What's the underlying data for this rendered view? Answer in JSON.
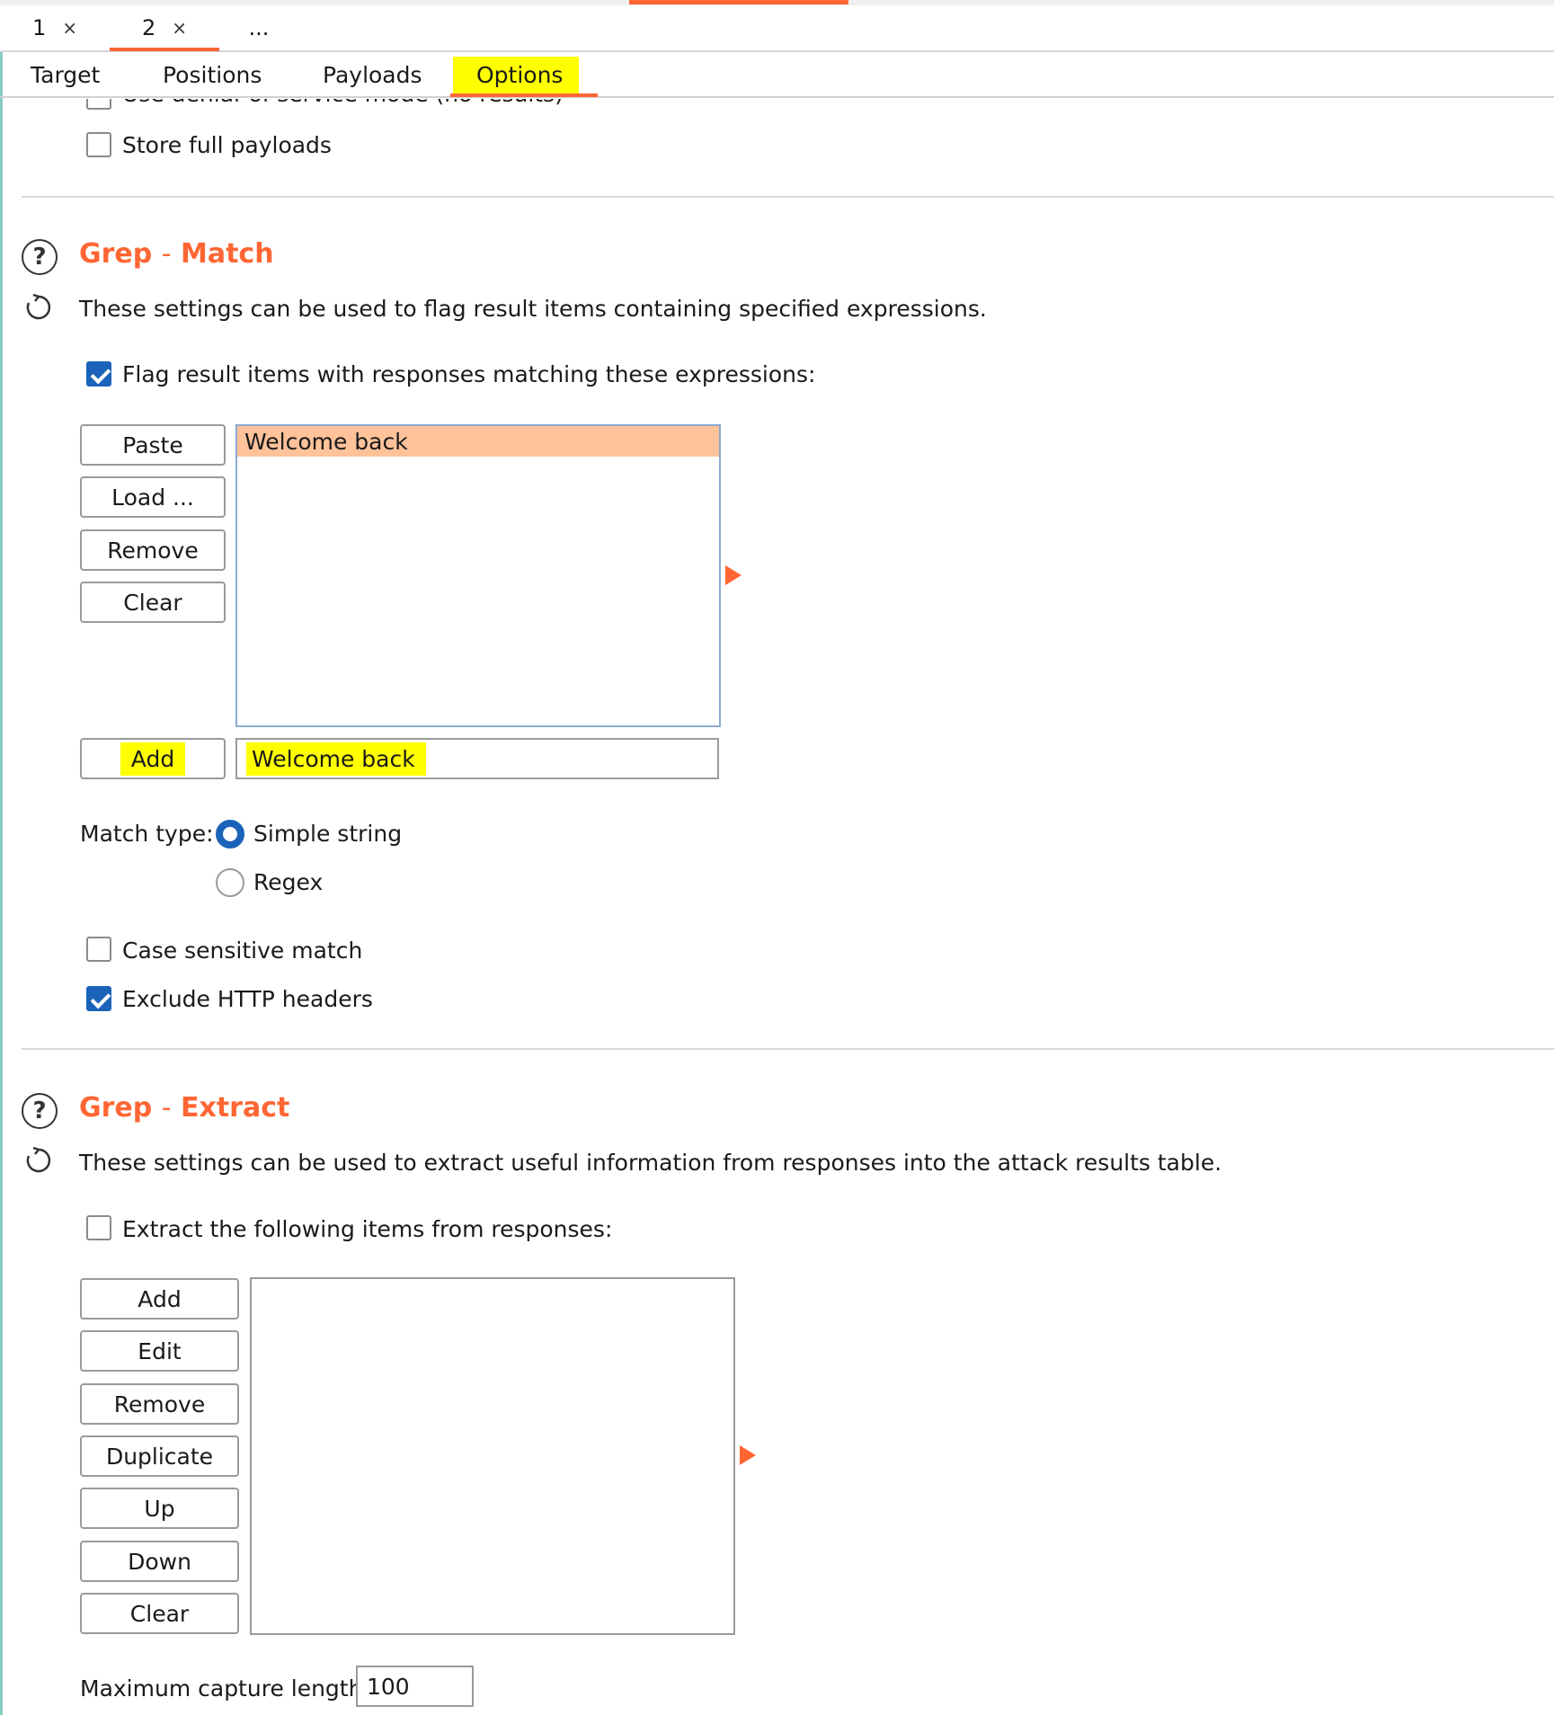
{
  "attack_tabs": [
    {
      "label": "1",
      "close": "×"
    },
    {
      "label": "2",
      "close": "×"
    },
    {
      "label": "..."
    }
  ],
  "sub_tabs": [
    "Target",
    "Positions",
    "Payloads",
    "Options"
  ],
  "active_sub_tab": "Options",
  "top_options": {
    "partial_label": "Use denial-of-service mode (no results)",
    "store_full_payloads": {
      "label": "Store full payloads",
      "checked": false
    }
  },
  "grep_match": {
    "title_a": "Grep",
    "title_sep": "-",
    "title_b": "Match",
    "description": "These settings can be used to flag result items containing specified expressions.",
    "flag_checkbox": {
      "label": "Flag result items with responses matching these expressions:",
      "checked": true
    },
    "buttons": {
      "paste": "Paste",
      "load": "Load ...",
      "remove": "Remove",
      "clear": "Clear",
      "add": "Add"
    },
    "list_items": [
      "Welcome back"
    ],
    "add_input_value": "Welcome back",
    "match_type_label": "Match type:",
    "match_types": [
      "Simple string",
      "Regex"
    ],
    "selected_match_type": "Simple string",
    "case_sensitive": {
      "label": "Case sensitive match",
      "checked": false
    },
    "exclude_headers": {
      "label": "Exclude HTTP headers",
      "checked": true
    }
  },
  "grep_extract": {
    "title_a": "Grep",
    "title_sep": "-",
    "title_b": "Extract",
    "description": "These settings can be used to extract useful information from responses into the attack results table.",
    "extract_checkbox": {
      "label": "Extract the following items from responses:",
      "checked": false
    },
    "buttons": {
      "add": "Add",
      "edit": "Edit",
      "remove": "Remove",
      "duplicate": "Duplicate",
      "up": "Up",
      "down": "Down",
      "clear": "Clear"
    },
    "max_capture_label": "Maximum capture length:",
    "max_capture_value": "100"
  },
  "colors": {
    "accent": "#ff6633",
    "checkbox_blue": "#1b63b9",
    "highlight": "#ffff00",
    "selected_row": "#ffc299"
  }
}
